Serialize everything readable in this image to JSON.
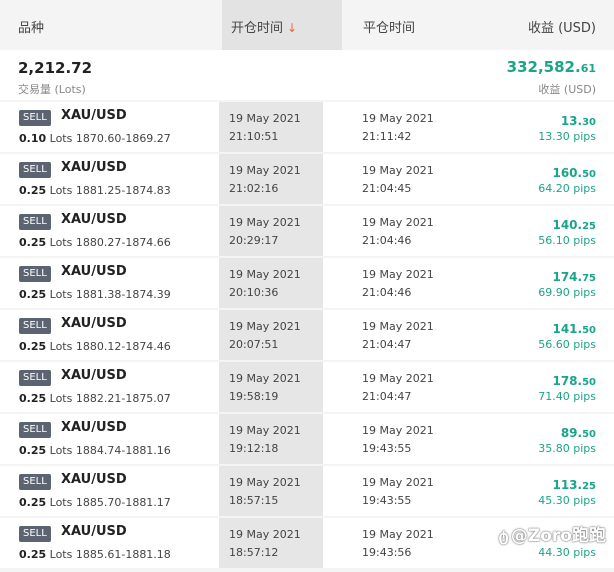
{
  "header": {
    "col_instrument": "品种",
    "col_open_time": "开仓时间",
    "sort_arrow": "↓",
    "col_close_time": "平仓时间",
    "col_profit": "收益 (USD)"
  },
  "summary": {
    "lots": "2,212.72",
    "lots_label": "交易量 (Lots)",
    "profit_int": "332,582.",
    "profit_dec": "61",
    "profit_label": "收益 (USD)"
  },
  "trades": [
    {
      "side": "SELL",
      "symbol": "XAU/USD",
      "lots": "0.10",
      "lots_unit": "Lots",
      "prices": "1870.60-1869.27",
      "open_date": "19 May 2021",
      "open_time": "21:10:51",
      "close_date": "19 May 2021",
      "close_time": "21:11:42",
      "profit_int": "13.",
      "profit_dec": "30",
      "pips": "13.30 pips"
    },
    {
      "side": "SELL",
      "symbol": "XAU/USD",
      "lots": "0.25",
      "lots_unit": "Lots",
      "prices": "1881.25-1874.83",
      "open_date": "19 May 2021",
      "open_time": "21:02:16",
      "close_date": "19 May 2021",
      "close_time": "21:04:45",
      "profit_int": "160.",
      "profit_dec": "50",
      "pips": "64.20 pips"
    },
    {
      "side": "SELL",
      "symbol": "XAU/USD",
      "lots": "0.25",
      "lots_unit": "Lots",
      "prices": "1880.27-1874.66",
      "open_date": "19 May 2021",
      "open_time": "20:29:17",
      "close_date": "19 May 2021",
      "close_time": "21:04:46",
      "profit_int": "140.",
      "profit_dec": "25",
      "pips": "56.10 pips"
    },
    {
      "side": "SELL",
      "symbol": "XAU/USD",
      "lots": "0.25",
      "lots_unit": "Lots",
      "prices": "1881.38-1874.39",
      "open_date": "19 May 2021",
      "open_time": "20:10:36",
      "close_date": "19 May 2021",
      "close_time": "21:04:46",
      "profit_int": "174.",
      "profit_dec": "75",
      "pips": "69.90 pips"
    },
    {
      "side": "SELL",
      "symbol": "XAU/USD",
      "lots": "0.25",
      "lots_unit": "Lots",
      "prices": "1880.12-1874.46",
      "open_date": "19 May 2021",
      "open_time": "20:07:51",
      "close_date": "19 May 2021",
      "close_time": "21:04:47",
      "profit_int": "141.",
      "profit_dec": "50",
      "pips": "56.60 pips"
    },
    {
      "side": "SELL",
      "symbol": "XAU/USD",
      "lots": "0.25",
      "lots_unit": "Lots",
      "prices": "1882.21-1875.07",
      "open_date": "19 May 2021",
      "open_time": "19:58:19",
      "close_date": "19 May 2021",
      "close_time": "21:04:47",
      "profit_int": "178.",
      "profit_dec": "50",
      "pips": "71.40 pips"
    },
    {
      "side": "SELL",
      "symbol": "XAU/USD",
      "lots": "0.25",
      "lots_unit": "Lots",
      "prices": "1884.74-1881.16",
      "open_date": "19 May 2021",
      "open_time": "19:12:18",
      "close_date": "19 May 2021",
      "close_time": "19:43:55",
      "profit_int": "89.",
      "profit_dec": "50",
      "pips": "35.80 pips"
    },
    {
      "side": "SELL",
      "symbol": "XAU/USD",
      "lots": "0.25",
      "lots_unit": "Lots",
      "prices": "1885.70-1881.17",
      "open_date": "19 May 2021",
      "open_time": "18:57:15",
      "close_date": "19 May 2021",
      "close_time": "19:43:55",
      "profit_int": "113.",
      "profit_dec": "25",
      "pips": "45.30 pips"
    },
    {
      "side": "SELL",
      "symbol": "XAU/USD",
      "lots": "0.25",
      "lots_unit": "Lots",
      "prices": "1885.61-1881.18",
      "open_date": "19 May 2021",
      "open_time": "18:57:12",
      "close_date": "19 May 2021",
      "close_time": "19:43:56",
      "profit_int": "",
      "profit_dec": "",
      "pips": "44.30 pips"
    }
  ],
  "watermark": {
    "icon": "swirl-icon",
    "text": "@Zoro跑跑"
  },
  "colors": {
    "profit_green": "#1aa48a",
    "sort_arrow": "#e8663d",
    "badge_bg": "#5b6470",
    "highlight_col": "#e6e6e6"
  }
}
